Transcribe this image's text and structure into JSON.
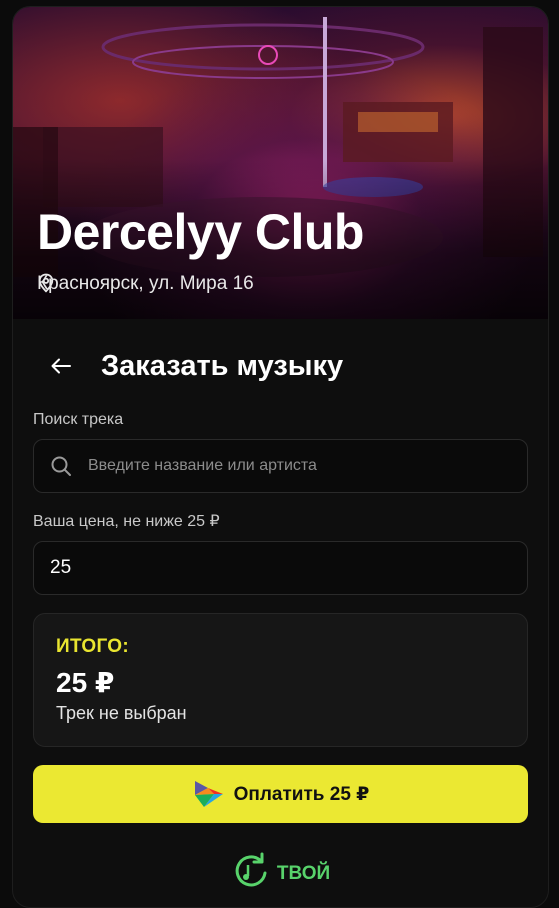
{
  "venue": {
    "name": "Dercelyy Club",
    "address": "Красноярск, ул. Мира 16"
  },
  "page": {
    "title": "Заказать музыку"
  },
  "search": {
    "label": "Поиск трека",
    "placeholder": "Введите название или артиста",
    "value": ""
  },
  "price": {
    "label": "Ваша цена, не ниже 25 ₽",
    "value": "25"
  },
  "summary": {
    "label": "ИТОГО:",
    "amount": "25 ₽",
    "track_status": "Трек не выбран"
  },
  "pay_button": {
    "label": "Оплатить 25 ₽"
  },
  "footer": {
    "brand_text": "ТВОЙ"
  },
  "colors": {
    "accent": "#ebe832",
    "brand_green": "#58d36b",
    "background": "#0e0e0e"
  }
}
